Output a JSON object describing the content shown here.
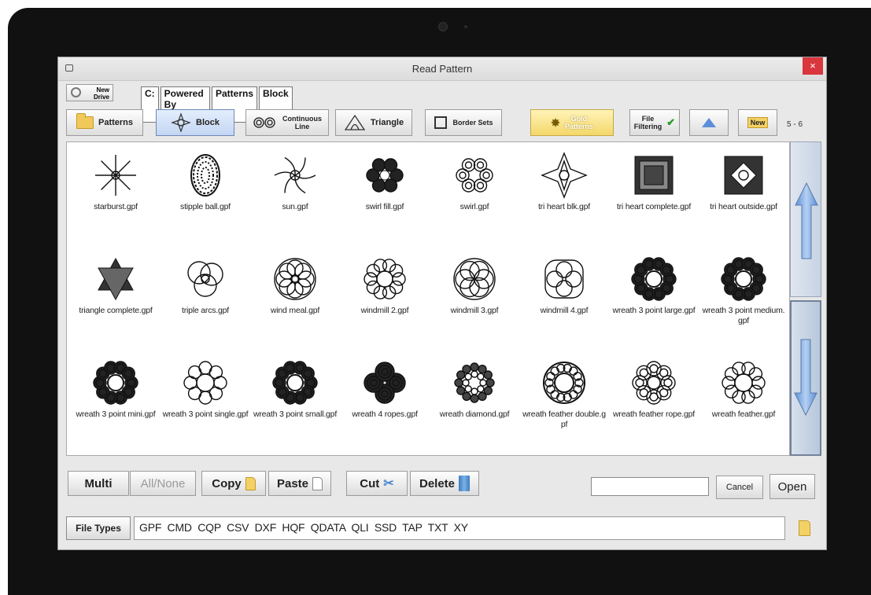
{
  "window": {
    "title": "Read Pattern",
    "close_label": "×"
  },
  "pathbar": {
    "new_drive_label_1": "New",
    "new_drive_label_2": "Drive",
    "crumbs": [
      "C:",
      "Powered By QuiltCAD",
      "Patterns",
      "Block"
    ]
  },
  "toolbar": {
    "patterns": "Patterns",
    "block": "Block",
    "continuous_1": "Continuous",
    "continuous_2": "Line",
    "triangle": "Triangle",
    "border_sets": "Border Sets",
    "gold_1": "Gold",
    "gold_2": "Patterns",
    "filtering_1": "File",
    "filtering_2": "Filtering",
    "new": "New",
    "page_indicator": "5 - 6"
  },
  "files": [
    {
      "name": "starburst.gpf",
      "icon": "starburst"
    },
    {
      "name": "stipple ball.gpf",
      "icon": "stipple"
    },
    {
      "name": "sun.gpf",
      "icon": "sun"
    },
    {
      "name": "swirl fill.gpf",
      "icon": "swirlfill"
    },
    {
      "name": "swirl.gpf",
      "icon": "swirl"
    },
    {
      "name": "tri heart blk.gpf",
      "icon": "triheart"
    },
    {
      "name": "tri heart complete.gpf",
      "icon": "square"
    },
    {
      "name": "tri heart outside.gpf",
      "icon": "squareout"
    },
    {
      "name": "triangle complete.gpf",
      "icon": "star6"
    },
    {
      "name": "triple arcs.gpf",
      "icon": "arcs"
    },
    {
      "name": "wind meal.gpf",
      "icon": "pinwheel"
    },
    {
      "name": "windmill 2.gpf",
      "icon": "petals"
    },
    {
      "name": "windmill 3.gpf",
      "icon": "rosette"
    },
    {
      "name": "windmill 4.gpf",
      "icon": "loops"
    },
    {
      "name": "wreath 3 point large.gpf",
      "icon": "wreath"
    },
    {
      "name": "wreath 3 point medium.gpf",
      "icon": "wreath"
    },
    {
      "name": "wreath 3 point mini.gpf",
      "icon": "wreath"
    },
    {
      "name": "wreath 3 point single.gpf",
      "icon": "wreathsingle"
    },
    {
      "name": "wreath 3 point small.gpf",
      "icon": "wreath"
    },
    {
      "name": "wreath 4 ropes.gpf",
      "icon": "ropes"
    },
    {
      "name": "wreath diamond.gpf",
      "icon": "diamond"
    },
    {
      "name": "wreath feather double.gpf",
      "icon": "featherdouble"
    },
    {
      "name": "wreath feather rope.gpf",
      "icon": "featherrope"
    },
    {
      "name": "wreath feather.gpf",
      "icon": "feather"
    }
  ],
  "actions": {
    "multi": "Multi",
    "all_none": "All/None",
    "copy": "Copy",
    "paste": "Paste",
    "cut": "Cut",
    "delete": "Delete",
    "cancel": "Cancel",
    "open": "Open",
    "filename_value": ""
  },
  "filetypes": {
    "button": "File Types",
    "list": "GPF  CMD  CQP  CSV  DXF  HQF  QDATA  QLI  SSD  TAP  TXT  XY"
  },
  "colors": {
    "scroll_blue": "#5b8fd8",
    "gold": "#f4d76a",
    "close_red": "#d9363e"
  }
}
